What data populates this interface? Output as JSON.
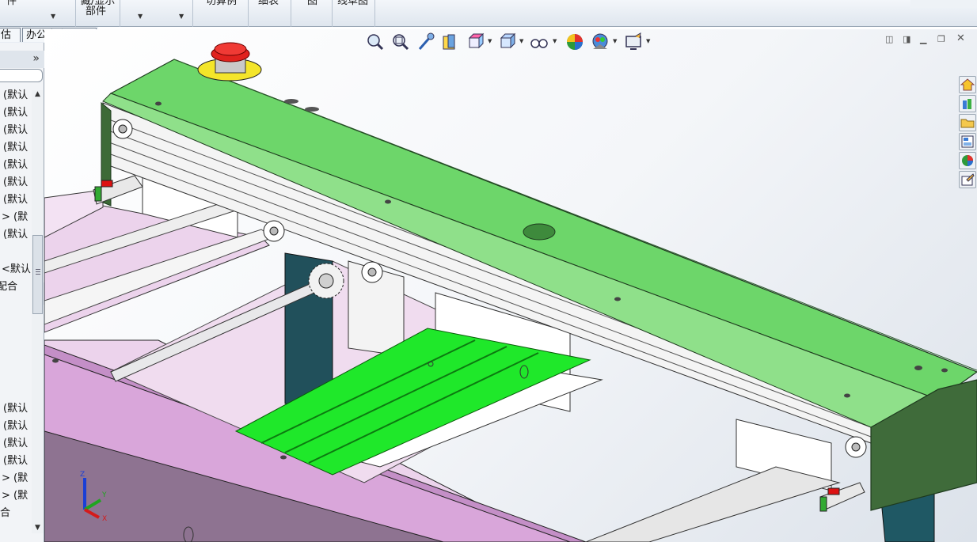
{
  "ribbon": {
    "items": [
      {
        "label": "件"
      },
      {
        "label": "藏/显示"
      },
      {
        "label": "部件"
      },
      {
        "label": "切算例"
      },
      {
        "label": "细表"
      },
      {
        "label": "图"
      },
      {
        "label": "线草图"
      }
    ]
  },
  "tabs": [
    {
      "label": "估"
    },
    {
      "label": "办公室产品"
    }
  ],
  "tree": {
    "collapse_label": "»",
    "items_top": [
      "(默认",
      "(默认",
      "(默认",
      "(默认",
      "(默认",
      "(默认",
      "(默认",
      "> (默",
      "(默认"
    ],
    "items_mid": [
      "<默认",
      "配合"
    ],
    "items_bottom": [
      "(默认",
      "(默认",
      "(默认",
      "(默认",
      "> (默",
      "> (默",
      "合"
    ]
  },
  "hud": {
    "icons": [
      "zoom-to-fit-icon",
      "zoom-to-area-icon",
      "previous-view-icon",
      "section-view-icon",
      "view-orientation-icon",
      "display-style-icon",
      "hide-show-items-icon",
      "edit-appearance-icon",
      "apply-scene-icon",
      "view-settings-icon"
    ]
  },
  "window_controls": [
    "tile-left-icon",
    "tile-right-icon",
    "minimize-icon",
    "restore-icon",
    "close-icon"
  ],
  "task_pane": [
    "resources-home-icon",
    "design-library-icon",
    "file-explorer-icon",
    "view-palette-icon",
    "appearances-icon",
    "custom-properties-icon"
  ],
  "triad": {
    "x": "X",
    "y": "Y",
    "z": "Z"
  },
  "colors": {
    "cover_green": "#6fd66a",
    "cover_dark_green": "#3f6b3a",
    "slide_green": "#22e82a",
    "frame_pink": "#d7a3d8",
    "frame_light": "#ecd3ec",
    "post_teal": "#215a66",
    "estop_red": "#e0221e",
    "estop_yellow": "#f4e52a"
  }
}
